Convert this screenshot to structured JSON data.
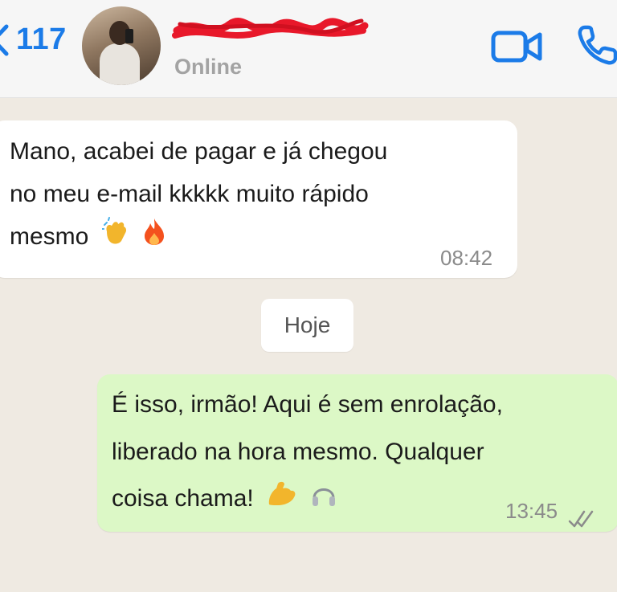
{
  "header": {
    "back_count": "117",
    "status": "Online"
  },
  "messages": [
    {
      "lines": [
        "Mano, acabei de pagar e já chegou",
        "no meu e-mail kkkkk muito rápido",
        "mesmo"
      ],
      "emojis": [
        "clapping-hands-icon",
        "fire-icon"
      ],
      "time": "08:42"
    },
    {
      "lines": [
        "É isso, irmão! Aqui é sem enrolação,",
        "liberado na hora mesmo. Qualquer",
        "coisa chama!"
      ],
      "emojis": [
        "flexed-biceps-icon",
        "headphones-icon"
      ],
      "time": "13:45",
      "read_receipt": "double-check-icon"
    }
  ],
  "date_divider": "Hoje",
  "colors": {
    "accent": "#1b7be8",
    "outgoing_bubble": "#dcf8c6",
    "incoming_bubble": "#ffffff",
    "chat_background": "#efeae2",
    "redaction": "#e8182a"
  }
}
